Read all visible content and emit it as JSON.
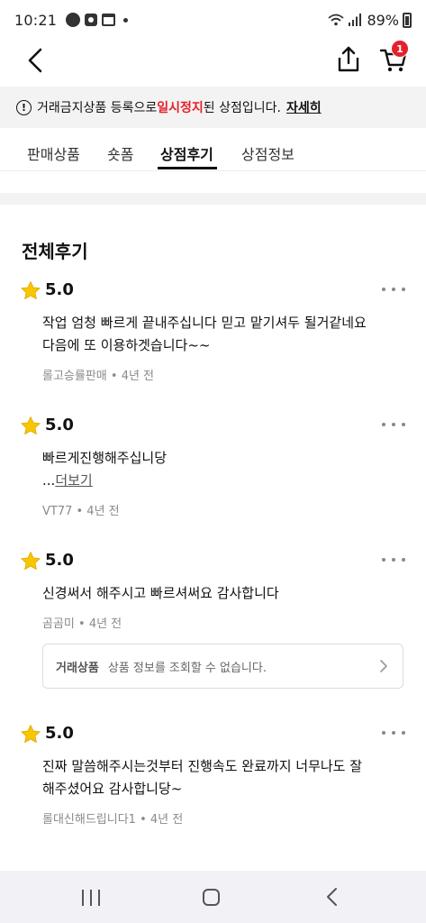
{
  "status_bar": {
    "time": "10:21",
    "battery": "89%",
    "talk_badge": "TALK"
  },
  "header": {
    "cart_count": "1"
  },
  "notice": {
    "prefix": "거래금지상품 등록으로 ",
    "highlight": "일시정지",
    "suffix": "된 상점입니다.",
    "link": "자세히",
    "highlight_color": "#e5202a"
  },
  "tabs": [
    {
      "label": "판매상품"
    },
    {
      "label": "숏폼"
    },
    {
      "label": "상점후기"
    },
    {
      "label": "상점정보"
    }
  ],
  "reviews_title": "전체후기",
  "reviews": [
    {
      "score": "5.0",
      "lines": [
        "작업 엄청 빠르게 끝내주십니다 믿고 맡기셔두 될거같네요",
        "다음에 또 이용하겟습니다~~"
      ],
      "meta": "롤고승률판매 • 4년 전"
    },
    {
      "score": "5.0",
      "lines": [
        "빠르게진행해주십니당"
      ],
      "ellipsis": "...",
      "read_more": "더보기",
      "meta": "VT77 • 4년 전"
    },
    {
      "score": "5.0",
      "lines": [
        "신경써서 해주시고 빠르셔써요 감사합니다"
      ],
      "meta": "곰곰미 • 4년 전",
      "product_box": {
        "label": "거래상품",
        "text": "상품 정보를 조회할 수 없습니다."
      }
    },
    {
      "score": "5.0",
      "lines": [
        "진짜 말씀해주시는것부터 진행속도 완료까지 너무나도 잘",
        "해주셨어요 감사합니당~"
      ],
      "meta": "롤대신해드립니다1 • 4년 전"
    }
  ],
  "colors": {
    "star": "#f7c600",
    "accent_red": "#e5202a"
  },
  "icons": [
    "back-arrow-icon",
    "share-icon",
    "cart-icon",
    "star-icon",
    "more-icon",
    "chevron-right-icon",
    "alert-icon"
  ]
}
